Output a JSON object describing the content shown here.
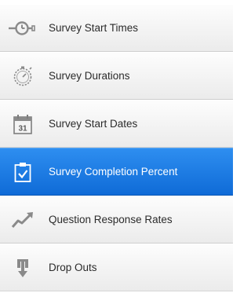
{
  "menu": {
    "items": [
      {
        "label": "Survey Start Times",
        "icon": "clock-arrow-icon",
        "active": false
      },
      {
        "label": "Survey Durations",
        "icon": "stopwatch-icon",
        "active": false
      },
      {
        "label": "Survey Start Dates",
        "icon": "calendar-icon",
        "active": false,
        "icon_text": "31"
      },
      {
        "label": "Survey Completion Percent",
        "icon": "clipboard-check-icon",
        "active": true
      },
      {
        "label": "Question Response Rates",
        "icon": "trend-line-icon",
        "active": false
      },
      {
        "label": "Drop Outs",
        "icon": "exit-arrow-icon",
        "active": false
      }
    ]
  },
  "colors": {
    "active_background": "#1a7ce4",
    "active_text": "#ffffff",
    "item_text": "#2b2b2b",
    "icon_gray": "#8a8a8a"
  }
}
